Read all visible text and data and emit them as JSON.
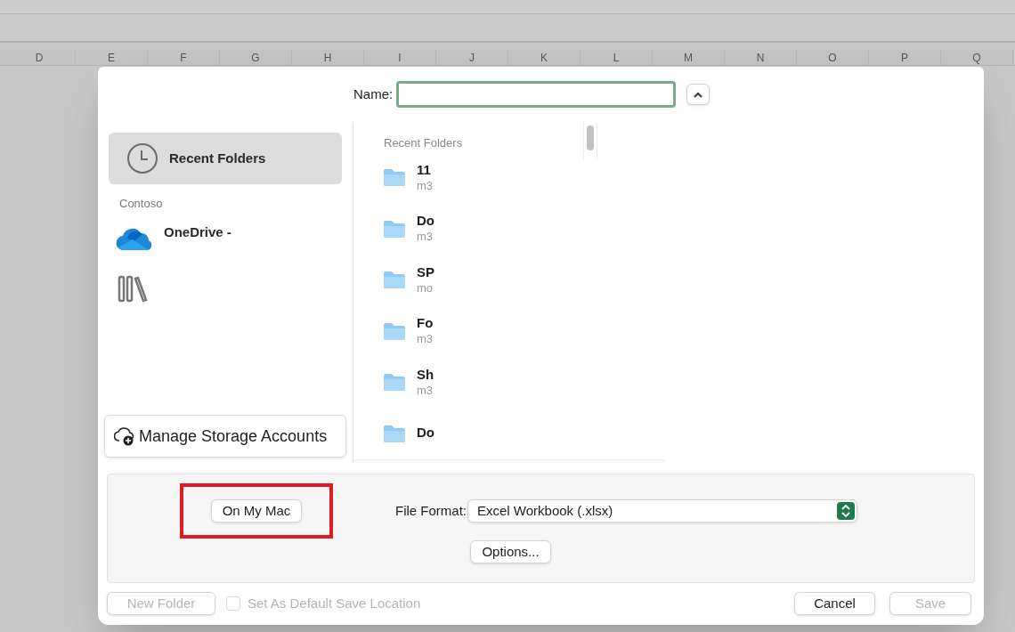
{
  "sheet": {
    "columns": [
      "D",
      "E",
      "F",
      "G",
      "H",
      "I",
      "J",
      "K",
      "L",
      "M",
      "N",
      "O",
      "P",
      "Q"
    ]
  },
  "dialog": {
    "name_label": "Name:",
    "sidebar": {
      "items": [
        {
          "kind": "recent",
          "label": "Recent Folders",
          "selected": true
        },
        {
          "kind": "section",
          "label": "Contoso"
        },
        {
          "kind": "cloud",
          "label": "OneDrive -",
          "selected": false
        },
        {
          "kind": "library",
          "selected": false
        }
      ],
      "manage_button": "Manage Storage Accounts"
    },
    "list": {
      "header": "Recent Folders",
      "folders": [
        {
          "name": "11",
          "detail": "m3"
        },
        {
          "name": "Do",
          "detail": "m3"
        },
        {
          "name": "SP",
          "detail": "mo"
        },
        {
          "name": "Fo",
          "detail": "m3"
        },
        {
          "name": "Sh",
          "detail": "m3"
        },
        {
          "name": "Do"
        }
      ]
    },
    "options": {
      "location_button": "On My Mac",
      "highlighted": true,
      "format_label": "File Format:",
      "format_value": "Excel Workbook (.xlsx)",
      "options_button": "Options..."
    },
    "footer": {
      "new_folder": {
        "label": "New Folder",
        "disabled": true
      },
      "default_checkbox": {
        "label": "Set As Default Save Location",
        "checked": false,
        "disabled": true
      },
      "cancel": {
        "label": "Cancel",
        "disabled": false
      },
      "save": {
        "label": "Save",
        "disabled": true
      }
    }
  }
}
